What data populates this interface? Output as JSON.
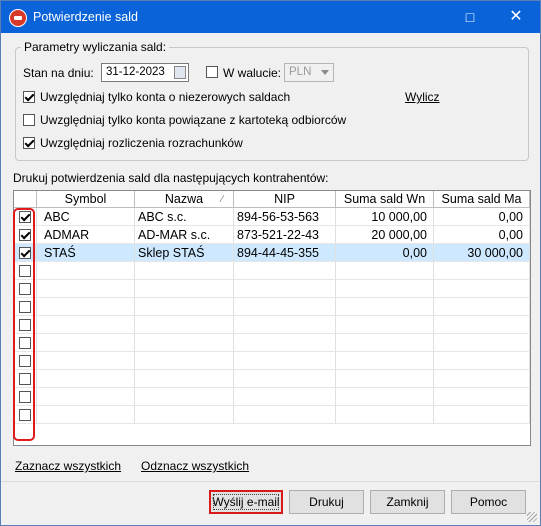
{
  "window": {
    "title": "Potwierdzenie sald"
  },
  "params": {
    "legend": "Parametry wyliczania sald:",
    "date_label": "Stan na dniu:",
    "date_value": "31-12-2023",
    "currency_label": "W walucie:",
    "currency_value": "PLN",
    "calc_link": "Wylicz",
    "options": [
      {
        "label": "Uwzględniaj tylko konta o niezerowych saldach",
        "checked": true
      },
      {
        "label": "Uwzględniaj tylko konta powiązane z kartoteką odbiorców",
        "checked": false
      },
      {
        "label": "Uwzględniaj rozliczenia rozrachunków",
        "checked": true
      }
    ]
  },
  "list_caption": "Drukuj potwierdzenia sald dla następujących kontrahentów:",
  "table": {
    "columns": [
      "Symbol",
      "Nazwa",
      "NIP",
      "Suma sald Wn",
      "Suma sald Ma"
    ],
    "rows": [
      {
        "checked": true,
        "selected": false,
        "cells": [
          "ABC",
          "ABC s.c.",
          "894-56-53-563",
          "10 000,00",
          "0,00"
        ]
      },
      {
        "checked": true,
        "selected": false,
        "cells": [
          "ADMAR",
          "AD-MAR s.c.",
          "873-521-22-43",
          "20 000,00",
          "0,00"
        ]
      },
      {
        "checked": true,
        "selected": true,
        "cells": [
          "STAŚ",
          "Sklep STAŚ",
          "894-44-45-355",
          "0,00",
          "30 000,00"
        ]
      }
    ],
    "empty_rows": 9
  },
  "links": {
    "select_all": "Zaznacz wszystkich",
    "deselect_all": "Odznacz wszystkich"
  },
  "buttons": {
    "email": "Wyślij e-mail",
    "print": "Drukuj",
    "close": "Zamknij",
    "help": "Pomoc"
  },
  "colors": {
    "titlebar": "#0a63d8",
    "highlight": "#d81a1a",
    "selection": "#cde8ff"
  },
  "icons": {
    "app": "app-logo-icon",
    "calendar": "calendar-icon",
    "maximize": "maximize-icon",
    "close": "close-icon"
  }
}
